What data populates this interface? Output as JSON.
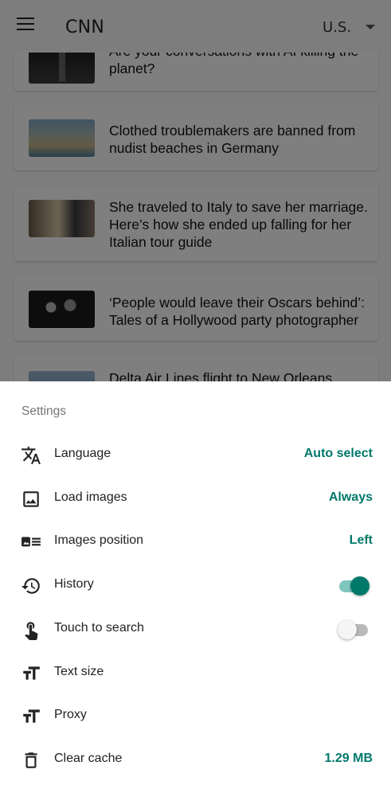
{
  "app": {
    "title": "CNN",
    "region": "U.S.",
    "articles": [
      {
        "headline": "Are your conversations with AI killing the planet?"
      },
      {
        "headline": "Clothed troublemakers are banned from nudist beaches in Germany"
      },
      {
        "headline": "She traveled to Italy to save her marriage. Here’s how she ended up falling for her Italian tour guide"
      },
      {
        "headline": "‘People would leave their Oscars behind’: Tales of a Hollywood party photographer"
      },
      {
        "headline": "Delta Air Lines flight to New Orleans"
      }
    ]
  },
  "settings": {
    "title": "Settings",
    "items": [
      {
        "icon": "translate-icon",
        "label": "Language",
        "value": "Auto select"
      },
      {
        "icon": "image-icon",
        "label": "Load images",
        "value": "Always"
      },
      {
        "icon": "image-position-icon",
        "label": "Images position",
        "value": "Left"
      },
      {
        "icon": "history-icon",
        "label": "History",
        "toggle": true
      },
      {
        "icon": "touch-icon",
        "label": "Touch to search",
        "toggle": false
      },
      {
        "icon": "text-size-icon",
        "label": "Text size"
      },
      {
        "icon": "text-size-icon",
        "label": "Proxy"
      },
      {
        "icon": "delete-icon",
        "label": "Clear cache",
        "value": "1.29 MB"
      }
    ]
  },
  "colors": {
    "accent": "#00796b",
    "accent_track": "#7fc6bd",
    "scrim": "rgba(0,0,0,0.5)"
  }
}
